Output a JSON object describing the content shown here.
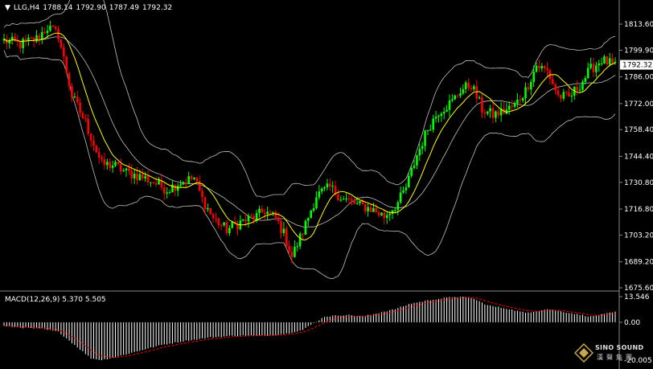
{
  "header": {
    "symbol": "LLG,H4",
    "open": "1788.14",
    "high": "1792.90",
    "low": "1787.49",
    "close": "1792.32"
  },
  "macd_header": {
    "label": "MACD(12,26,9)",
    "macd_value": "5.370",
    "signal_value": "5.505"
  },
  "logo": {
    "text_en": "SINO SOUND",
    "text_cn": "漢聲集團"
  },
  "colors": {
    "background": "#000000",
    "bull": "#ffffff",
    "bear": "#ff0000",
    "bull_candle": "#00ff00",
    "ma": "#ffff00",
    "bands": "#c0c0c0",
    "macd_hist": "#ffffff",
    "signal": "#ff0000",
    "price_tag_bg": "#ffffff",
    "price_tag_text": "#000000"
  },
  "chart_data": [
    {
      "type": "candlestick",
      "panel": "main",
      "y_ticks": [
        "1813.60",
        "1799.90",
        "1786.00",
        "1772.00",
        "1758.40",
        "1744.40",
        "1730.80",
        "1716.80",
        "1703.20",
        "1689.20",
        "1675.60"
      ],
      "ylim": [
        1675.6,
        1813.6
      ],
      "current_price": "1792.32",
      "anchors": [
        [
          0,
          1805
        ],
        [
          6,
          1803
        ],
        [
          12,
          1806
        ],
        [
          16,
          1812
        ],
        [
          20,
          1808
        ],
        [
          25,
          1776
        ],
        [
          30,
          1762
        ],
        [
          36,
          1740
        ],
        [
          40,
          1740
        ],
        [
          45,
          1736
        ],
        [
          50,
          1734
        ],
        [
          55,
          1731
        ],
        [
          60,
          1727
        ],
        [
          65,
          1731
        ],
        [
          70,
          1733
        ],
        [
          73,
          1722
        ],
        [
          77,
          1712
        ],
        [
          82,
          1706
        ],
        [
          87,
          1710
        ],
        [
          93,
          1713
        ],
        [
          96,
          1716
        ],
        [
          100,
          1712
        ],
        [
          103,
          1704
        ],
        [
          106,
          1692
        ],
        [
          110,
          1705
        ],
        [
          115,
          1724
        ],
        [
          120,
          1728
        ],
        [
          125,
          1722
        ],
        [
          130,
          1719
        ],
        [
          135,
          1717
        ],
        [
          140,
          1713
        ],
        [
          145,
          1720
        ],
        [
          148,
          1728
        ],
        [
          152,
          1745
        ],
        [
          156,
          1759
        ],
        [
          160,
          1768
        ],
        [
          165,
          1773
        ],
        [
          168,
          1779
        ],
        [
          172,
          1782
        ],
        [
          176,
          1769
        ],
        [
          180,
          1766
        ],
        [
          184,
          1768
        ],
        [
          188,
          1771
        ],
        [
          192,
          1779
        ],
        [
          196,
          1792
        ],
        [
          200,
          1789
        ],
        [
          204,
          1776
        ],
        [
          208,
          1775
        ],
        [
          212,
          1782
        ],
        [
          216,
          1790
        ],
        [
          220,
          1795
        ],
        [
          223,
          1793
        ],
        [
          225,
          1791
        ]
      ],
      "ma_overlay": "short moving average",
      "bands_overlay": "Bollinger Bands"
    },
    {
      "type": "histogram",
      "panel": "macd",
      "y_ticks": [
        "13.546",
        "0.00",
        "-20.005"
      ],
      "ylim": [
        -20.005,
        13.546
      ],
      "macd_last": 5.37,
      "signal_last": 5.505,
      "anchors": [
        [
          0,
          -2
        ],
        [
          8,
          -3
        ],
        [
          14,
          -3.5
        ],
        [
          20,
          -5
        ],
        [
          26,
          -12
        ],
        [
          32,
          -19
        ],
        [
          36,
          -20
        ],
        [
          42,
          -18
        ],
        [
          50,
          -15
        ],
        [
          58,
          -12
        ],
        [
          66,
          -10
        ],
        [
          76,
          -8
        ],
        [
          86,
          -7
        ],
        [
          96,
          -7
        ],
        [
          104,
          -6
        ],
        [
          110,
          -4
        ],
        [
          118,
          3
        ],
        [
          126,
          4
        ],
        [
          132,
          3
        ],
        [
          138,
          5
        ],
        [
          144,
          7
        ],
        [
          150,
          10
        ],
        [
          158,
          12
        ],
        [
          166,
          13.5
        ],
        [
          172,
          13
        ],
        [
          178,
          9
        ],
        [
          186,
          7
        ],
        [
          192,
          5
        ],
        [
          200,
          7
        ],
        [
          208,
          5
        ],
        [
          216,
          3
        ],
        [
          225,
          5.4
        ]
      ]
    }
  ]
}
